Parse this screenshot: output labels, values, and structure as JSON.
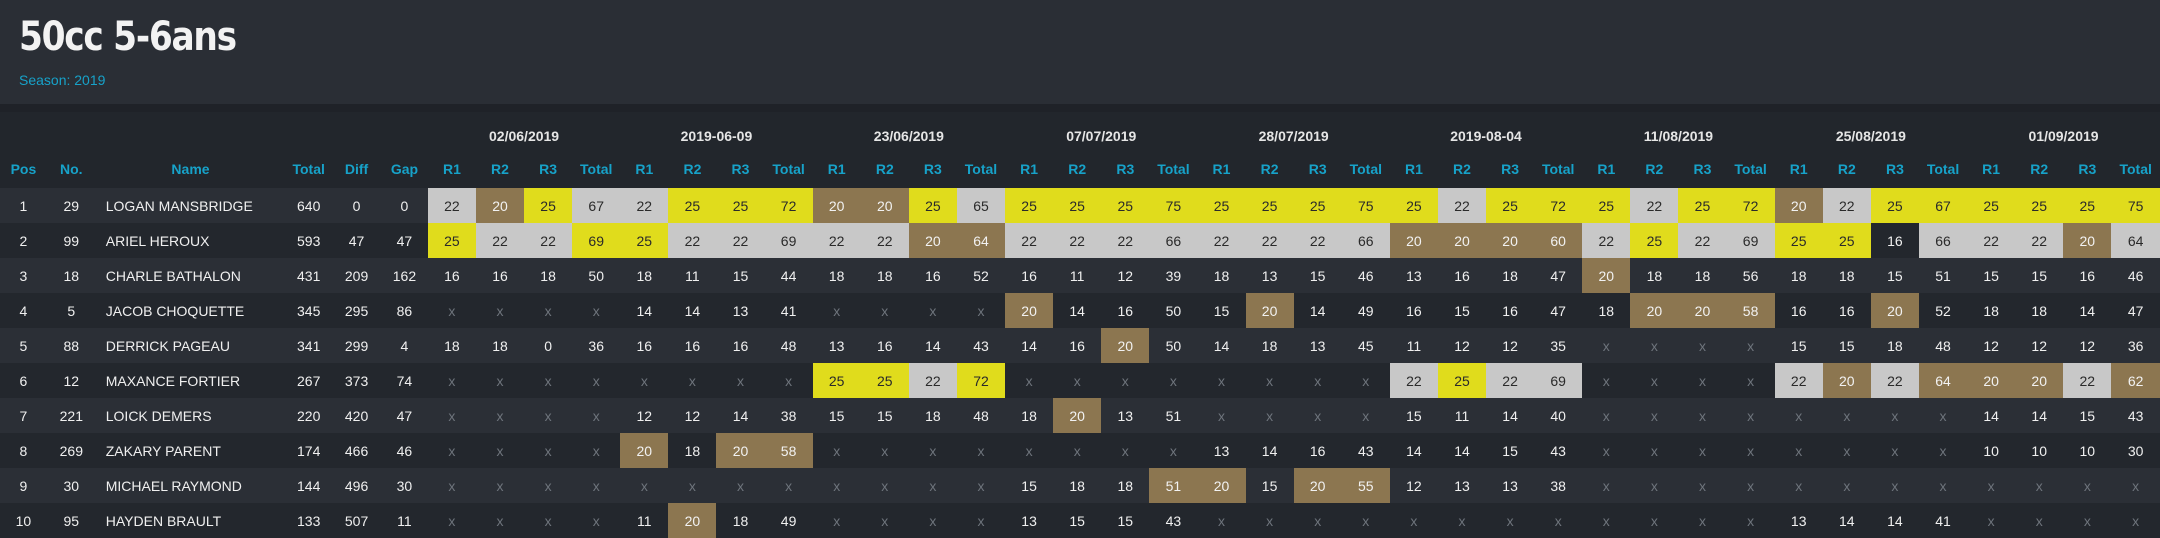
{
  "header": {
    "title": "50cc 5-6ans",
    "season": "Season: 2019"
  },
  "columns": {
    "pos": "Pos",
    "no": "No.",
    "name": "Name",
    "total": "Total",
    "diff": "Diff",
    "gap": "Gap",
    "race": [
      "R1",
      "R2",
      "R3",
      "Total"
    ]
  },
  "events": [
    "02/06/2019",
    "2019-06-09",
    "23/06/2019",
    "07/07/2019",
    "28/07/2019",
    "2019-08-04",
    "11/08/2019",
    "25/08/2019",
    "01/09/2019"
  ],
  "colors": {
    "gold": "#e0dc1c",
    "silver": "#c8c8c8",
    "bronze": "#8c7650",
    "accent": "#17a2c9"
  },
  "rows": [
    {
      "pos": "1",
      "no": "29",
      "name": "LOGAN MANSBRIDGE",
      "total": "640",
      "diff": "0",
      "gap": "0",
      "cells": [
        "22",
        "20",
        "25",
        "67",
        "22",
        "25",
        "25",
        "72",
        "20",
        "20",
        "25",
        "65",
        "25",
        "25",
        "25",
        "75",
        "25",
        "25",
        "25",
        "75",
        "25",
        "22",
        "25",
        "72",
        "25",
        "22",
        "25",
        "72",
        "20",
        "22",
        "25",
        "67",
        "25",
        "25",
        "25",
        "75"
      ],
      "colors": [
        "s",
        "b",
        "g",
        "s",
        "s",
        "g",
        "g",
        "g",
        "b",
        "b",
        "g",
        "s",
        "g",
        "g",
        "g",
        "g",
        "g",
        "g",
        "g",
        "g",
        "g",
        "s",
        "g",
        "g",
        "g",
        "s",
        "g",
        "g",
        "b",
        "s",
        "g",
        "g",
        "g",
        "g",
        "g",
        "g"
      ]
    },
    {
      "pos": "2",
      "no": "99",
      "name": "ARIEL HEROUX",
      "total": "593",
      "diff": "47",
      "gap": "47",
      "cells": [
        "25",
        "22",
        "22",
        "69",
        "25",
        "22",
        "22",
        "69",
        "22",
        "22",
        "20",
        "64",
        "22",
        "22",
        "22",
        "66",
        "22",
        "22",
        "22",
        "66",
        "20",
        "20",
        "20",
        "60",
        "22",
        "25",
        "22",
        "69",
        "25",
        "25",
        "16",
        "66",
        "22",
        "22",
        "20",
        "64"
      ],
      "colors": [
        "g",
        "s",
        "s",
        "g",
        "g",
        "s",
        "s",
        "s",
        "s",
        "s",
        "b",
        "b",
        "s",
        "s",
        "s",
        "s",
        "s",
        "s",
        "s",
        "s",
        "b",
        "b",
        "b",
        "b",
        "s",
        "g",
        "s",
        "s",
        "g",
        "g",
        "",
        "s",
        "s",
        "s",
        "b",
        "s"
      ]
    },
    {
      "pos": "3",
      "no": "18",
      "name": "CHARLE BATHALON",
      "total": "431",
      "diff": "209",
      "gap": "162",
      "cells": [
        "16",
        "16",
        "18",
        "50",
        "18",
        "11",
        "15",
        "44",
        "18",
        "18",
        "16",
        "52",
        "16",
        "11",
        "12",
        "39",
        "18",
        "13",
        "15",
        "46",
        "13",
        "16",
        "18",
        "47",
        "20",
        "18",
        "18",
        "56",
        "18",
        "18",
        "15",
        "51",
        "15",
        "15",
        "16",
        "46"
      ],
      "colors": [
        "",
        "",
        "",
        "",
        "",
        "",
        "",
        "",
        "",
        "",
        "",
        "",
        "",
        "",
        "",
        "",
        "",
        "",
        "",
        "",
        "",
        "",
        "",
        "",
        "b",
        "",
        "",
        "",
        "",
        "",
        "",
        "",
        "",
        "",
        "",
        ""
      ]
    },
    {
      "pos": "4",
      "no": "5",
      "name": "JACOB CHOQUETTE",
      "total": "345",
      "diff": "295",
      "gap": "86",
      "cells": [
        "x",
        "x",
        "x",
        "x",
        "14",
        "14",
        "13",
        "41",
        "x",
        "x",
        "x",
        "x",
        "20",
        "14",
        "16",
        "50",
        "15",
        "20",
        "14",
        "49",
        "16",
        "15",
        "16",
        "47",
        "18",
        "20",
        "20",
        "58",
        "16",
        "16",
        "20",
        "52",
        "18",
        "18",
        "14",
        "47"
      ],
      "colors": [
        "",
        "",
        "",
        "",
        "",
        "",
        "",
        "",
        "",
        "",
        "",
        "",
        "b",
        "",
        "",
        "",
        "",
        "b",
        "",
        "",
        "",
        "",
        "",
        "",
        "",
        "b",
        "b",
        "b",
        "",
        "",
        "b",
        "",
        "",
        "",
        "",
        ""
      ]
    },
    {
      "pos": "5",
      "no": "88",
      "name": "DERRICK PAGEAU",
      "total": "341",
      "diff": "299",
      "gap": "4",
      "cells": [
        "18",
        "18",
        "0",
        "36",
        "16",
        "16",
        "16",
        "48",
        "13",
        "16",
        "14",
        "43",
        "14",
        "16",
        "20",
        "50",
        "14",
        "18",
        "13",
        "45",
        "11",
        "12",
        "12",
        "35",
        "x",
        "x",
        "x",
        "x",
        "15",
        "15",
        "18",
        "48",
        "12",
        "12",
        "12",
        "36"
      ],
      "colors": [
        "",
        "",
        "",
        "",
        "",
        "",
        "",
        "",
        "",
        "",
        "",
        "",
        "",
        "",
        "b",
        "",
        "",
        "",
        "",
        "",
        "",
        "",
        "",
        "",
        "",
        "",
        "",
        "",
        "",
        "",
        "",
        "",
        "",
        "",
        "",
        ""
      ]
    },
    {
      "pos": "6",
      "no": "12",
      "name": "MAXANCE FORTIER",
      "total": "267",
      "diff": "373",
      "gap": "74",
      "cells": [
        "x",
        "x",
        "x",
        "x",
        "x",
        "x",
        "x",
        "x",
        "25",
        "25",
        "22",
        "72",
        "x",
        "x",
        "x",
        "x",
        "x",
        "x",
        "x",
        "x",
        "22",
        "25",
        "22",
        "69",
        "x",
        "x",
        "x",
        "x",
        "22",
        "20",
        "22",
        "64",
        "20",
        "20",
        "22",
        "62"
      ],
      "colors": [
        "",
        "",
        "",
        "",
        "",
        "",
        "",
        "",
        "g",
        "g",
        "s",
        "g",
        "",
        "",
        "",
        "",
        "",
        "",
        "",
        "",
        "s",
        "g",
        "s",
        "s",
        "",
        "",
        "",
        "",
        "s",
        "b",
        "s",
        "b",
        "b",
        "b",
        "s",
        "b"
      ]
    },
    {
      "pos": "7",
      "no": "221",
      "name": "LOICK DEMERS",
      "total": "220",
      "diff": "420",
      "gap": "47",
      "cells": [
        "x",
        "x",
        "x",
        "x",
        "12",
        "12",
        "14",
        "38",
        "15",
        "15",
        "18",
        "48",
        "18",
        "20",
        "13",
        "51",
        "x",
        "x",
        "x",
        "x",
        "15",
        "11",
        "14",
        "40",
        "x",
        "x",
        "x",
        "x",
        "x",
        "x",
        "x",
        "x",
        "14",
        "14",
        "15",
        "43"
      ],
      "colors": [
        "",
        "",
        "",
        "",
        "",
        "",
        "",
        "",
        "",
        "",
        "",
        "",
        "",
        "b",
        "",
        "",
        "",
        "",
        "",
        "",
        "",
        "",
        "",
        "",
        "",
        "",
        "",
        "",
        "",
        "",
        "",
        "",
        "",
        "",
        "",
        ""
      ]
    },
    {
      "pos": "8",
      "no": "269",
      "name": "ZAKARY PARENT",
      "total": "174",
      "diff": "466",
      "gap": "46",
      "cells": [
        "x",
        "x",
        "x",
        "x",
        "20",
        "18",
        "20",
        "58",
        "x",
        "x",
        "x",
        "x",
        "x",
        "x",
        "x",
        "x",
        "13",
        "14",
        "16",
        "43",
        "14",
        "14",
        "15",
        "43",
        "x",
        "x",
        "x",
        "x",
        "x",
        "x",
        "x",
        "x",
        "10",
        "10",
        "10",
        "30"
      ],
      "colors": [
        "",
        "",
        "",
        "",
        "b",
        "",
        "b",
        "b",
        "",
        "",
        "",
        "",
        "",
        "",
        "",
        "",
        "",
        "",
        "",
        "",
        "",
        "",
        "",
        "",
        "",
        "",
        "",
        "",
        "",
        "",
        "",
        "",
        "",
        "",
        "",
        ""
      ]
    },
    {
      "pos": "9",
      "no": "30",
      "name": "MICHAEL RAYMOND",
      "total": "144",
      "diff": "496",
      "gap": "30",
      "cells": [
        "x",
        "x",
        "x",
        "x",
        "x",
        "x",
        "x",
        "x",
        "x",
        "x",
        "x",
        "x",
        "15",
        "18",
        "18",
        "51",
        "20",
        "15",
        "20",
        "55",
        "12",
        "13",
        "13",
        "38",
        "x",
        "x",
        "x",
        "x",
        "x",
        "x",
        "x",
        "x",
        "x",
        "x",
        "x",
        "x"
      ],
      "colors": [
        "",
        "",
        "",
        "",
        "",
        "",
        "",
        "",
        "",
        "",
        "",
        "",
        "",
        "",
        "",
        "b",
        "b",
        "",
        "b",
        "b",
        "",
        "",
        "",
        "",
        "",
        "",
        "",
        "",
        "",
        "",
        "",
        "",
        "",
        "",
        "",
        ""
      ]
    },
    {
      "pos": "10",
      "no": "95",
      "name": "HAYDEN BRAULT",
      "total": "133",
      "diff": "507",
      "gap": "11",
      "cells": [
        "x",
        "x",
        "x",
        "x",
        "11",
        "20",
        "18",
        "49",
        "x",
        "x",
        "x",
        "x",
        "13",
        "15",
        "15",
        "43",
        "x",
        "x",
        "x",
        "x",
        "x",
        "x",
        "x",
        "x",
        "x",
        "x",
        "x",
        "x",
        "13",
        "14",
        "14",
        "41",
        "x",
        "x",
        "x",
        "x"
      ],
      "colors": [
        "",
        "",
        "",
        "",
        "",
        "b",
        "",
        "",
        "",
        "",
        "",
        "",
        "",
        "",
        "",
        "",
        "",
        "",
        "",
        "",
        "",
        "",
        "",
        "",
        "",
        "",
        "",
        "",
        "",
        "",
        "",
        "",
        "",
        "",
        "",
        ""
      ]
    }
  ]
}
